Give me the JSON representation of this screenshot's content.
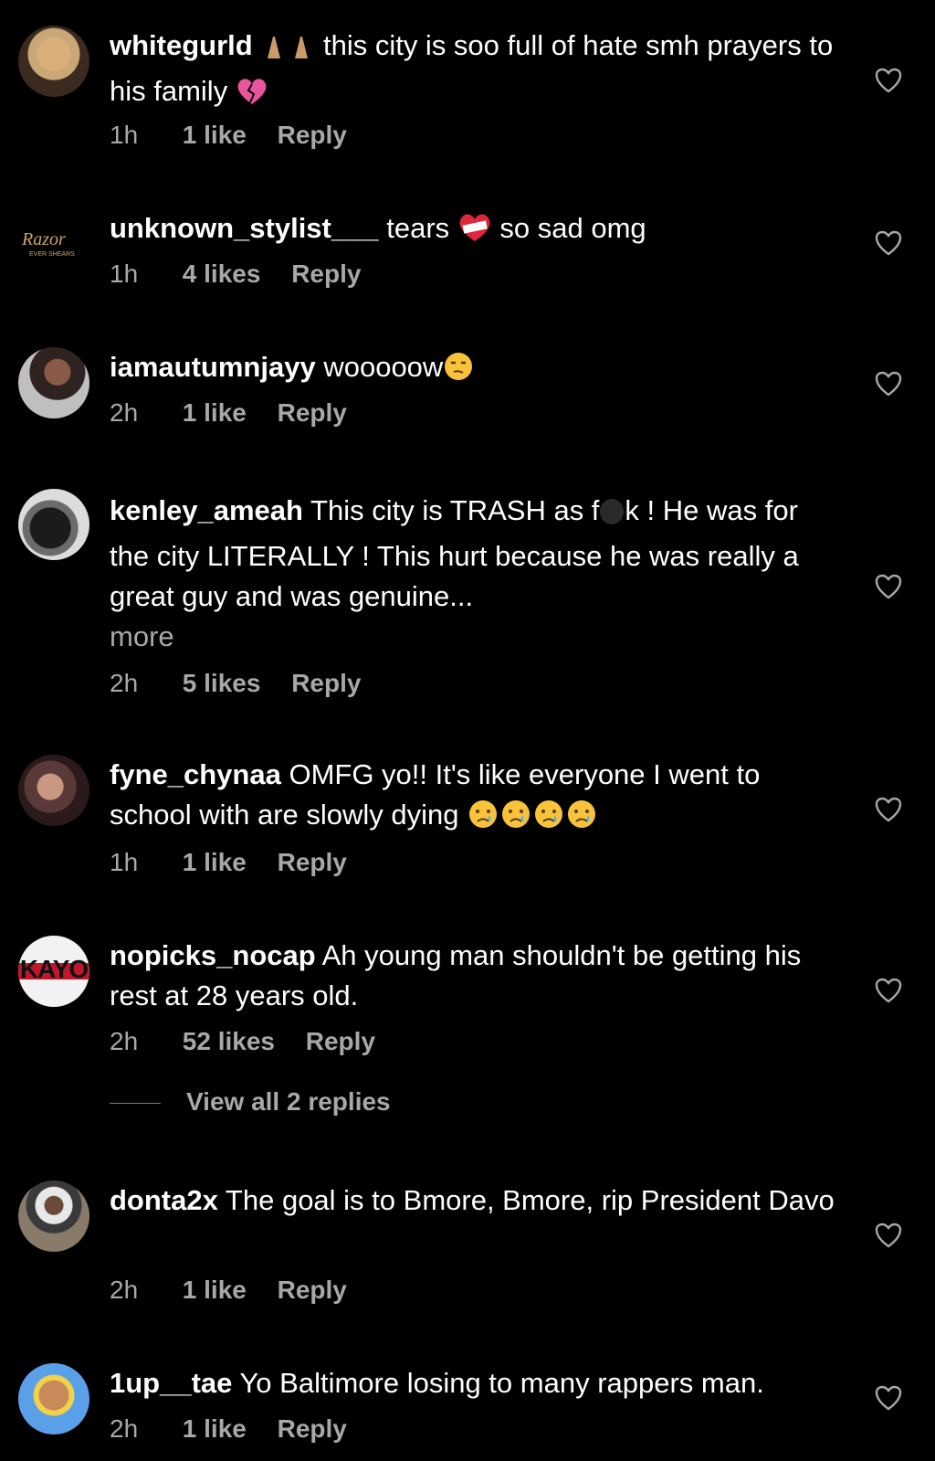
{
  "comments": [
    {
      "username": "whitegurld",
      "text_before": "",
      "text": "this city is soo full of hate smh prayers to his family",
      "emojis": [
        "folded-hands",
        "folded-hands",
        "broken-heart"
      ],
      "age": "1h",
      "likes": "1 like",
      "reply": "Reply"
    },
    {
      "username": "unknown_stylist___",
      "text": "tears",
      "text_after": "so sad omg",
      "emojis": [
        "mending-heart"
      ],
      "age": "1h",
      "likes": "4 likes",
      "reply": "Reply"
    },
    {
      "username": "iamautumnjayy",
      "text": "wooooow",
      "emojis": [
        "unamused-face"
      ],
      "age": "2h",
      "likes": "1 like",
      "reply": "Reply"
    },
    {
      "username": "kenley_ameah",
      "text": "This city is TRASH as f",
      "text_after": "k ! He was for the city LITERALLY ! This hurt because he was really a great guy and was genuine...",
      "more": "more",
      "age": "2h",
      "likes": "5 likes",
      "reply": "Reply"
    },
    {
      "username": "fyne_chynaa",
      "text": "OMFG yo!! It's like everyone I went to school with are slowly dying",
      "emojis": [
        "crying-face",
        "crying-face",
        "crying-face",
        "crying-face"
      ],
      "age": "1h",
      "likes": "1 like",
      "reply": "Reply"
    },
    {
      "username": "nopicks_nocap",
      "text": "Ah young man shouldn't be getting his rest at 28 years old.",
      "avatar_text": "KAYO",
      "age": "2h",
      "likes": "52 likes",
      "reply": "Reply"
    },
    {
      "username": "donta2x",
      "text": "The goal is to Bmore, Bmore, rip President Davo",
      "age": "2h",
      "likes": "1 like",
      "reply": "Reply"
    },
    {
      "username": "1up__tae",
      "text": "Yo Baltimore losing to many rappers man.",
      "age": "2h",
      "likes": "1 like",
      "reply": "Reply"
    }
  ],
  "view_replies": "View all 2 replies",
  "icons": {
    "like": "heart-outline-icon"
  },
  "colors": {
    "background": "#000000",
    "text": "#ffffff",
    "secondary": "#a8a8a8"
  }
}
